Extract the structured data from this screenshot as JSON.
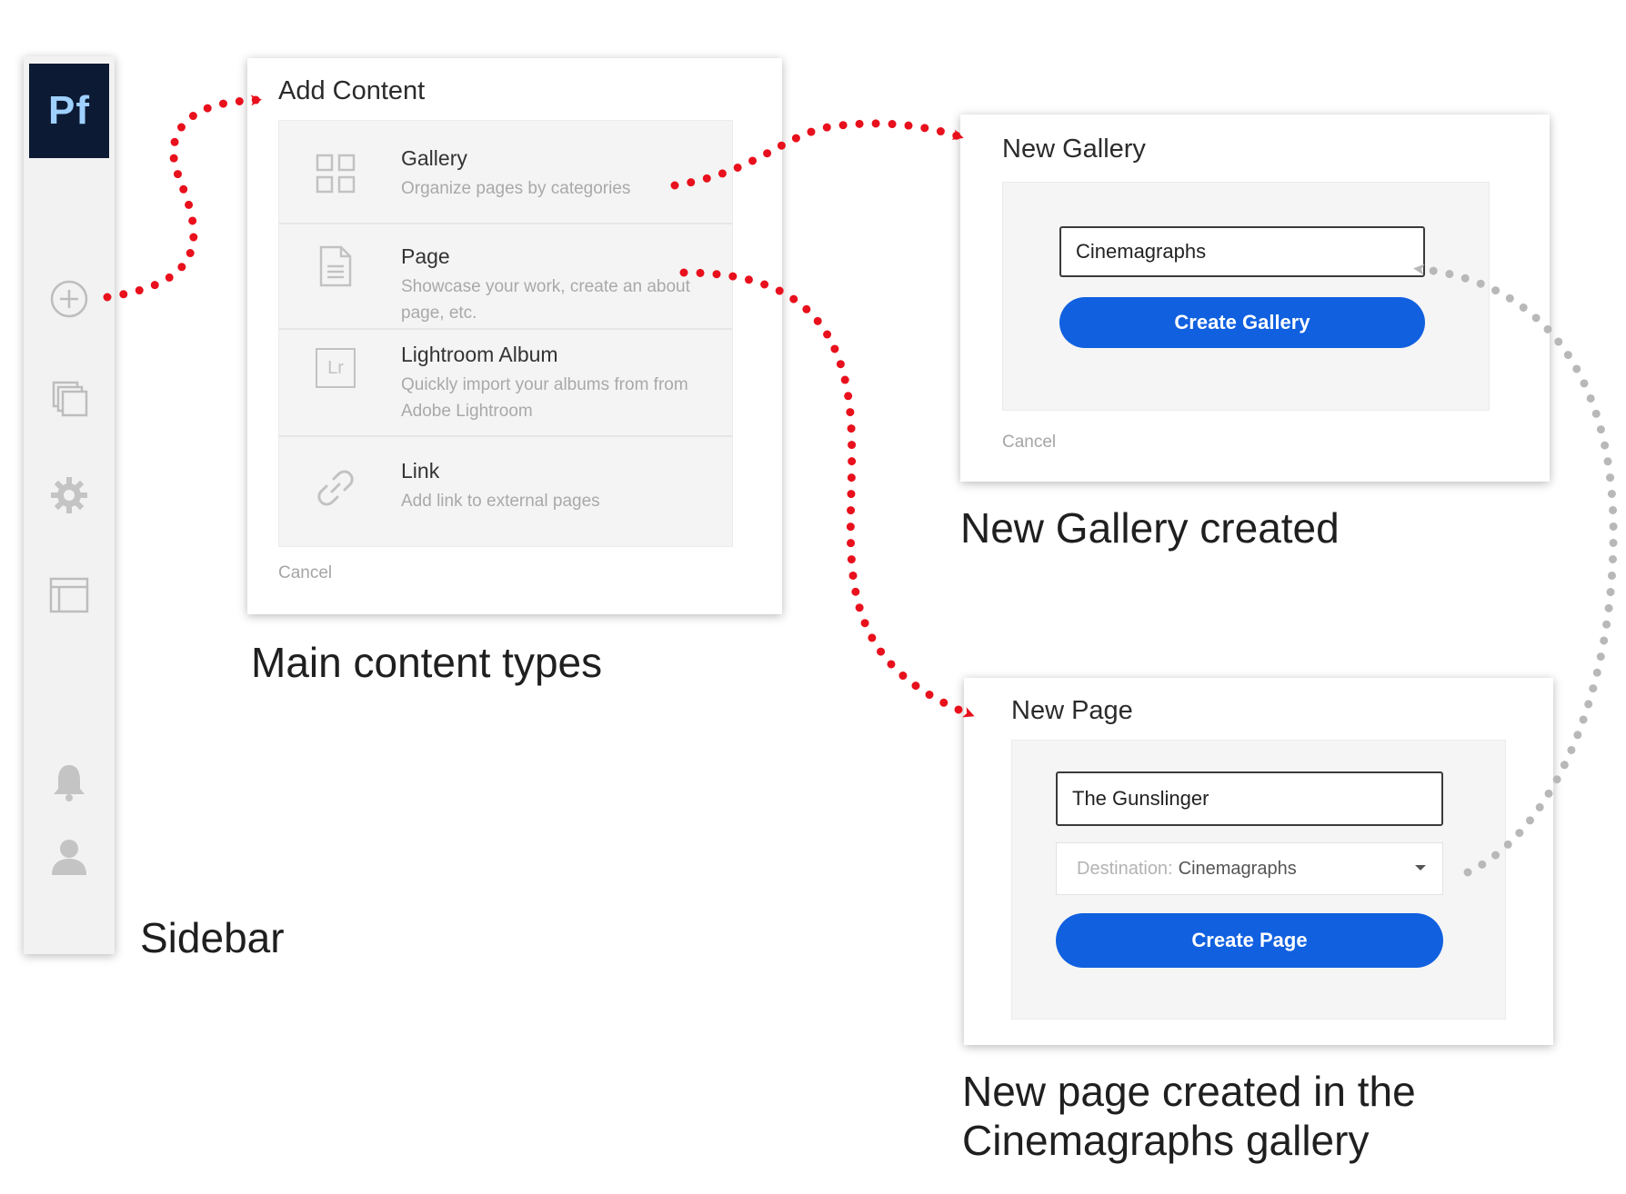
{
  "sidebar": {
    "logo": "Pf",
    "icons": [
      "plus-circle-icon",
      "stacked-pages-icon",
      "gear-icon",
      "layout-icon",
      "bell-icon",
      "user-icon"
    ]
  },
  "add_content": {
    "title": "Add Content",
    "items": [
      {
        "icon": "grid-icon",
        "title": "Gallery",
        "desc": "Organize pages by categories"
      },
      {
        "icon": "page-icon",
        "title": "Page",
        "desc": "Showcase your work, create an about page, etc."
      },
      {
        "icon": "lightroom-icon",
        "icon_text": "Lr",
        "title": "Lightroom Album",
        "desc": "Quickly import your albums from from Adobe Lightroom"
      },
      {
        "icon": "link-icon",
        "title": "Link",
        "desc": "Add link to external pages"
      }
    ],
    "cancel": "Cancel"
  },
  "new_gallery": {
    "title": "New Gallery",
    "field_value": "Cinemagraphs",
    "button": "Create Gallery",
    "cancel": "Cancel"
  },
  "new_page": {
    "title": "New Page",
    "field_value": "The Gunslinger",
    "destination_label": "Destination:",
    "destination_value": "Cinemagraphs",
    "button": "Create Page"
  },
  "captions": {
    "sidebar": "Sidebar",
    "main_content": "Main content types",
    "gallery_created": "New Gallery created",
    "page_created_line1": "New page created in the",
    "page_created_line2": "Cinemagraphs gallery"
  },
  "colors": {
    "accent_arrow": "#e8101c",
    "secondary_arrow": "#b8b8b8",
    "primary_button": "#1060e0",
    "logo_bg": "#0c1a33",
    "logo_text": "#9fd0ff"
  }
}
